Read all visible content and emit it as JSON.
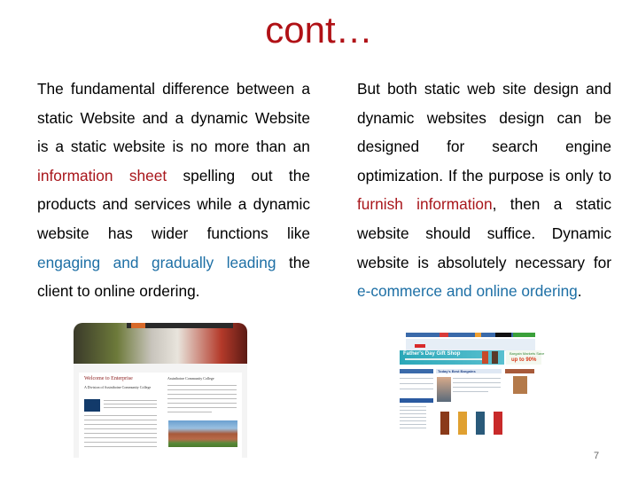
{
  "slide": {
    "title": "cont…",
    "page_number": "7",
    "colors": {
      "title": "#b01116",
      "emphasis_red": "#a8161b",
      "emphasis_blue": "#1d6fa5",
      "body": "#000000"
    }
  },
  "left_column": {
    "lines": [
      [
        {
          "t": "The fundamental difference between a",
          "c": ""
        }
      ],
      [
        {
          "t": "static Website and a dynamic Website",
          "c": ""
        }
      ],
      [
        {
          "t": "is a static website is no more than an",
          "c": ""
        }
      ],
      [
        {
          "t": "information sheet",
          "c": "red"
        },
        {
          "t": " spelling out the",
          "c": ""
        }
      ],
      [
        {
          "t": "products and services while a dynamic",
          "c": ""
        }
      ],
      [
        {
          "t": "website has wider functions like",
          "c": ""
        }
      ],
      [
        {
          "t": "engaging and gradually leading",
          "c": "blue"
        },
        {
          "t": " the",
          "c": ""
        }
      ],
      [
        {
          "t": "client to online ordering.",
          "c": ""
        }
      ]
    ]
  },
  "right_column": {
    "lines": [
      [
        {
          "t": "But both static web site design and",
          "c": ""
        }
      ],
      [
        {
          "t": "dynamic websites design can be",
          "c": ""
        }
      ],
      [
        {
          "t": "designed for search engine",
          "c": ""
        }
      ],
      [
        {
          "t": "optimization. If the purpose is only to",
          "c": ""
        }
      ],
      [
        {
          "t": "furnish information",
          "c": "red"
        },
        {
          "t": ", then a static",
          "c": ""
        }
      ],
      [
        {
          "t": "website should suffice. Dynamic",
          "c": ""
        }
      ],
      [
        {
          "t": "website is absolutely necessary for",
          "c": ""
        }
      ],
      [
        {
          "t": "e-commerce and online ordering",
          "c": "blue"
        },
        {
          "t": ".",
          "c": ""
        }
      ]
    ]
  },
  "images": {
    "static_site": {
      "heading": "Welcome to Enterprise",
      "subheading": "A Division of Assiniboine Community College",
      "right_heading": "Assiniboine Community College"
    },
    "dynamic_site": {
      "banner": "Father's Day Gift Shop",
      "sale_label": "Bargain Markets Save",
      "sale_value": "up to 90%",
      "section_heading": "Today's Best Bargains"
    }
  }
}
